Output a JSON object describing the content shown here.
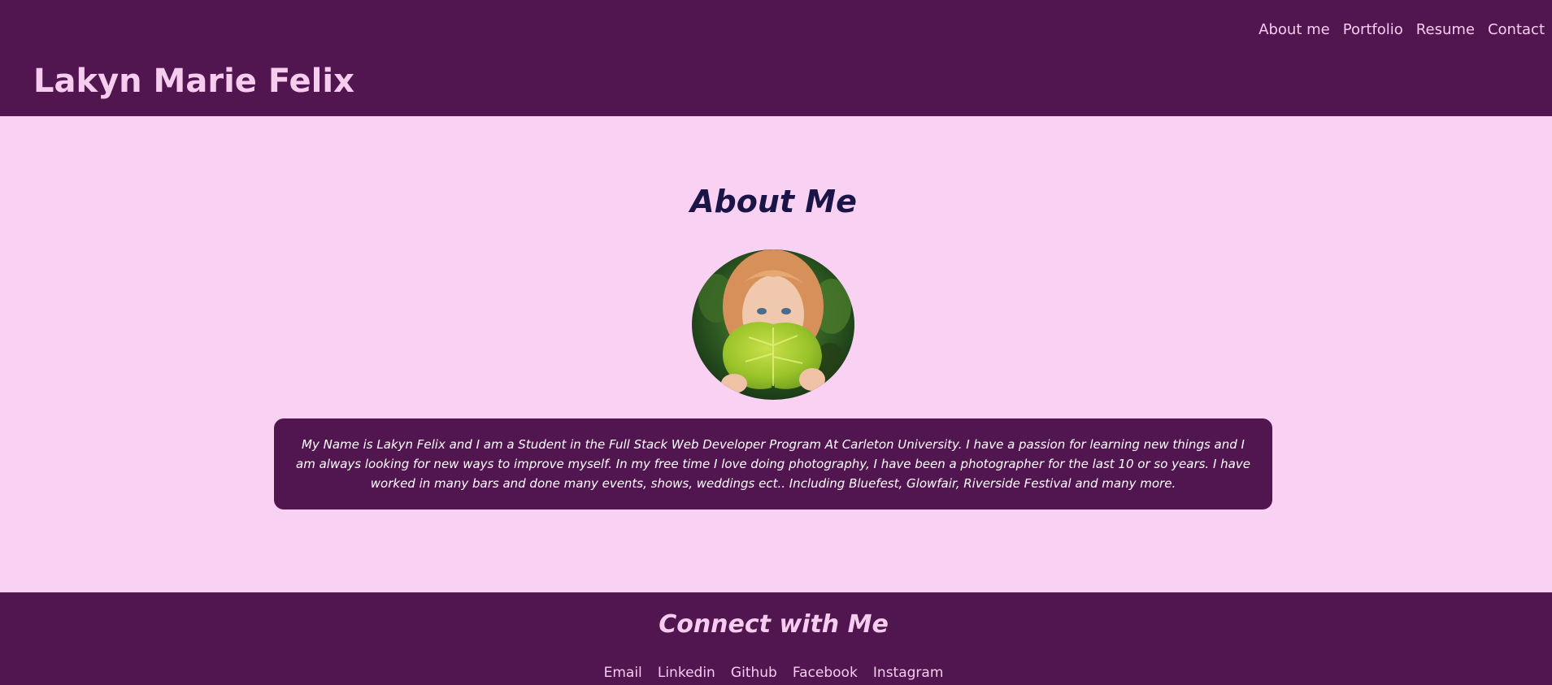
{
  "header": {
    "title": "Lakyn Marie Felix",
    "nav": [
      {
        "label": "About me"
      },
      {
        "label": "Portfolio"
      },
      {
        "label": "Resume"
      },
      {
        "label": "Contact"
      }
    ]
  },
  "about": {
    "heading": "About Me",
    "bio": "My Name is Lakyn Felix and I am a Student in the Full Stack Web Developer Program At Carleton University. I have a passion for learning new things and I am always looking for new ways to improve myself. In my free time I love doing photography, I have been a photographer for the last 10 or so years. I have worked in many bars and done many events, shows, weddings ect.. Including Bluefest, Glowfair, Riverside Festival and many more."
  },
  "footer": {
    "heading": "Connect with Me",
    "links": [
      {
        "label": "Email"
      },
      {
        "label": "Linkedin"
      },
      {
        "label": "Github"
      },
      {
        "label": "Facebook"
      },
      {
        "label": "Instagram"
      }
    ]
  },
  "colors": {
    "header_bg": "#51154f",
    "page_bg": "#f9d2f3",
    "title_text": "#f7cdef",
    "heading_text": "#1b1447",
    "bio_text": "#ffffff"
  }
}
